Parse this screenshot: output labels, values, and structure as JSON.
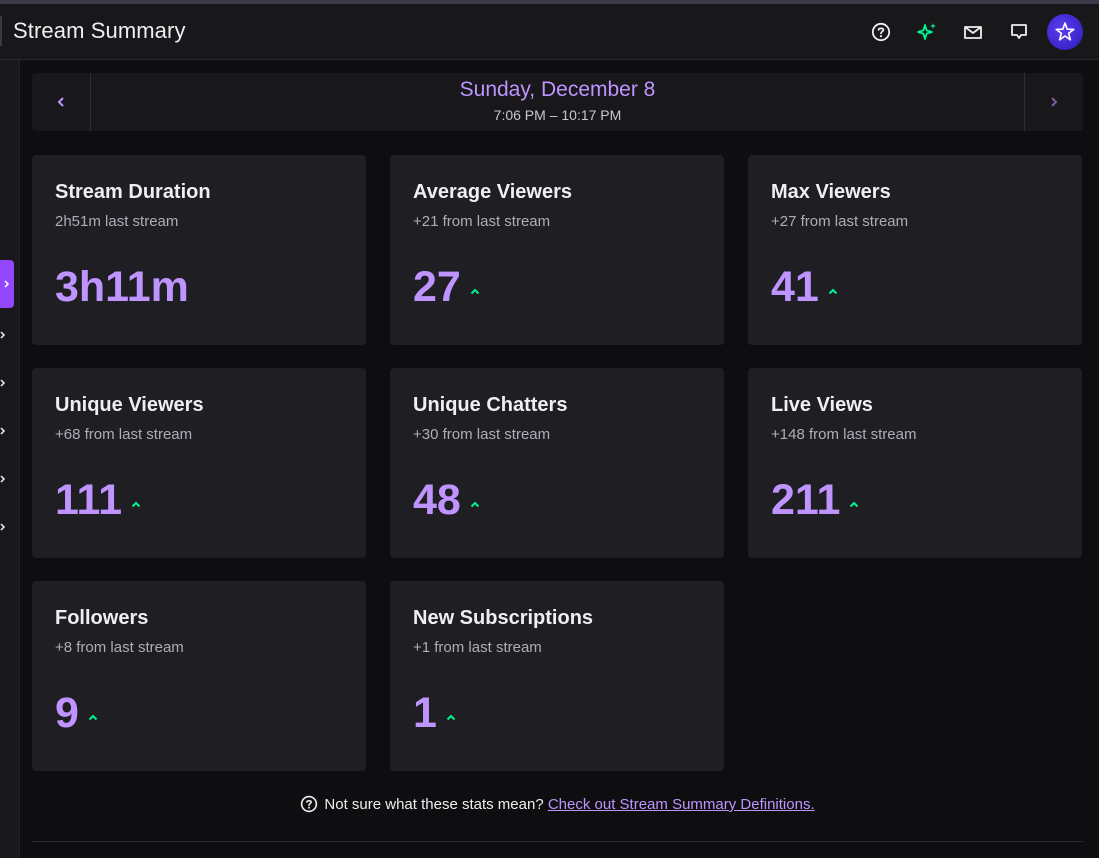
{
  "header": {
    "title": "Stream Summary"
  },
  "date_nav": {
    "date": "Sunday, December 8",
    "time_range": "7:06 PM – 10:17 PM"
  },
  "cards": [
    {
      "title": "Stream Duration",
      "subtitle": "2h51m last stream",
      "value": "3h11m",
      "trend_up": false
    },
    {
      "title": "Average Viewers",
      "subtitle": "+21 from last stream",
      "value": "27",
      "trend_up": true
    },
    {
      "title": "Max Viewers",
      "subtitle": "+27 from last stream",
      "value": "41",
      "trend_up": true
    },
    {
      "title": "Unique Viewers",
      "subtitle": "+68 from last stream",
      "value": "111",
      "trend_up": true
    },
    {
      "title": "Unique Chatters",
      "subtitle": "+30 from last stream",
      "value": "48",
      "trend_up": true
    },
    {
      "title": "Live Views",
      "subtitle": "+148 from last stream",
      "value": "211",
      "trend_up": true
    },
    {
      "title": "Followers",
      "subtitle": "+8 from last stream",
      "value": "9",
      "trend_up": true
    },
    {
      "title": "New Subscriptions",
      "subtitle": "+1 from last stream",
      "value": "1",
      "trend_up": true
    }
  ],
  "footer": {
    "question": "Not sure what these stats mean?",
    "link": "Check out Stream Summary Definitions."
  },
  "colors": {
    "accent": "#bf94ff",
    "trend_up": "#00f593",
    "brand": "#9147ff"
  },
  "icons": {
    "help": "help-icon",
    "sparkle": "sparkle-icon",
    "inbox": "inbox-icon",
    "whispers": "whispers-icon",
    "avatar": "avatar",
    "prev": "chevron-left-icon",
    "next": "chevron-right-icon",
    "trend": "trend-up-icon"
  }
}
